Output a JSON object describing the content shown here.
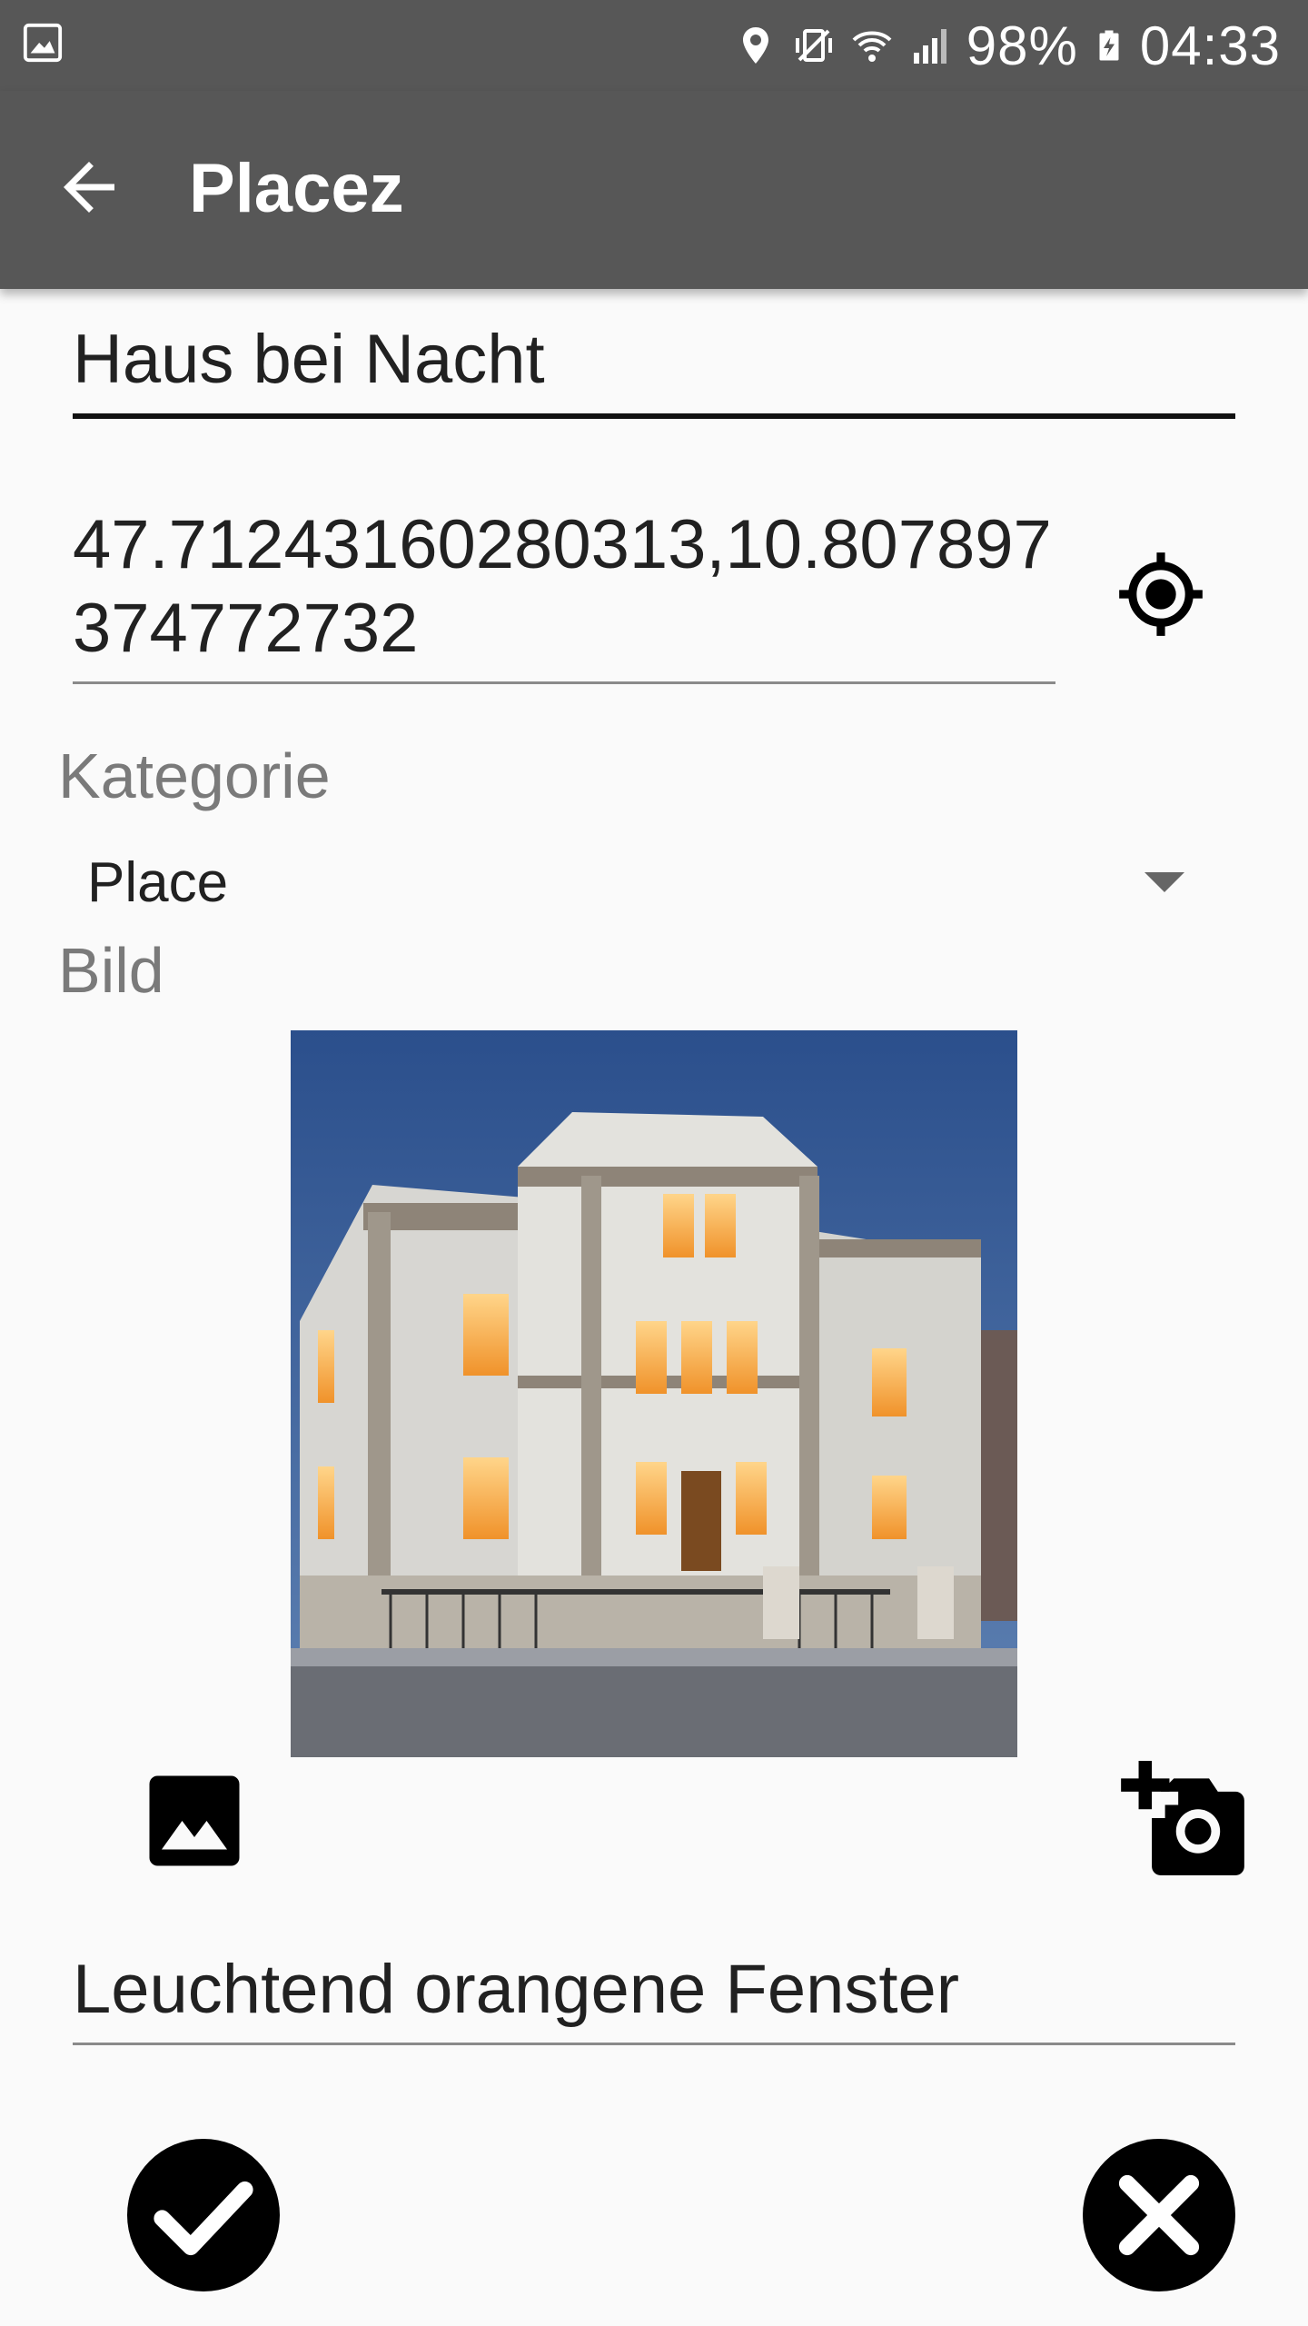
{
  "status_bar": {
    "battery": "98%",
    "time": "04:33",
    "icons": [
      "image-icon",
      "location-pin-icon",
      "vibrate-mute-icon",
      "wifi-icon",
      "cell-signal-icon",
      "battery-charging-icon"
    ]
  },
  "app_bar": {
    "title": "Placez",
    "back_icon": "arrow-back-icon"
  },
  "form": {
    "name_value": "Haus bei Nacht",
    "coordinates_value": "47.71243160280313,10.807897374772732",
    "location_icon": "gps-target-icon",
    "category_label": "Kategorie",
    "category_selected": "Place",
    "image_label": "Bild",
    "image_description": "Leuchtend orangene Fenster",
    "gallery_icon": "gallery-image-icon",
    "camera_icon": "add-camera-icon"
  },
  "actions": {
    "confirm_icon": "checkmark-circle-icon",
    "cancel_icon": "close-circle-icon"
  },
  "colors": {
    "toolbar": "#575757",
    "background": "#fafafa",
    "label": "#7a7a7a",
    "text": "#212121"
  }
}
